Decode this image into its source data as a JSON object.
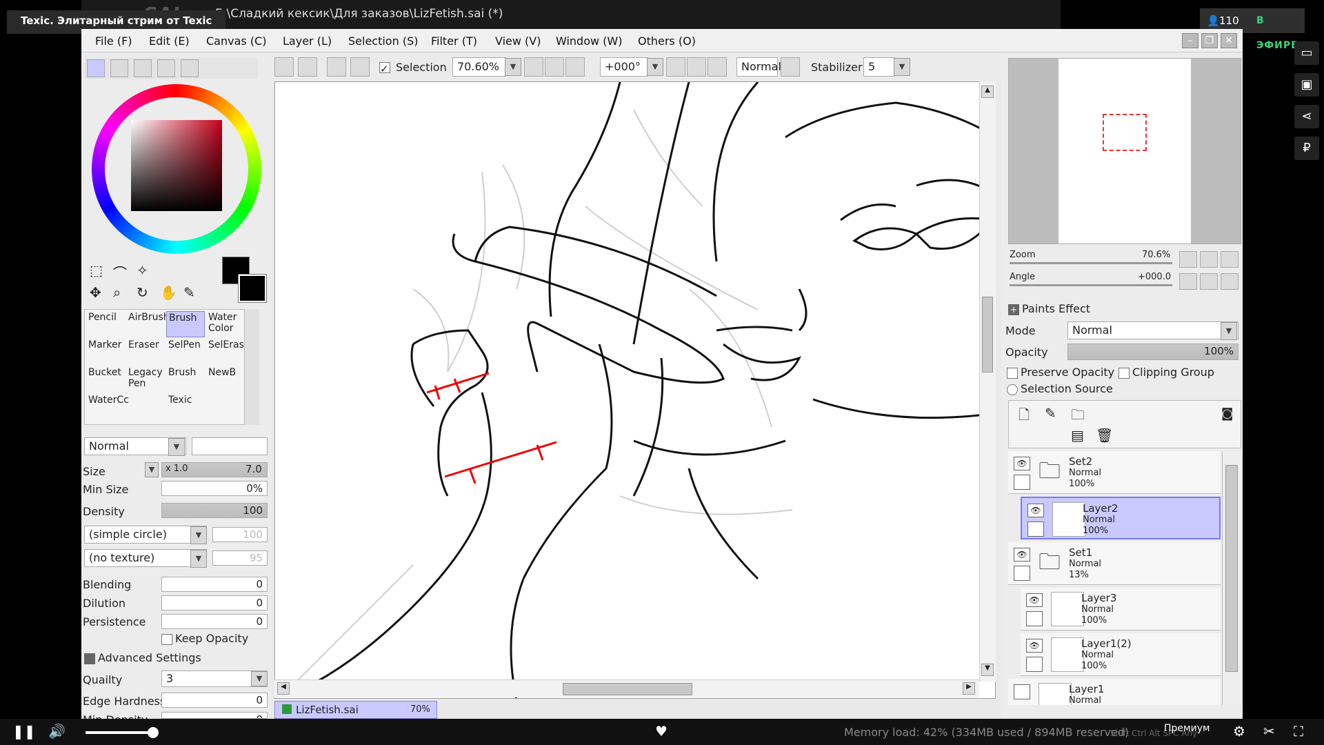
{
  "stream": {
    "title": "Texic. Элитарный стрим от Texic",
    "viewers": "110",
    "live": "В ЭФИРЕ",
    "premium": "Премиум"
  },
  "app": {
    "logo": "SAI",
    "path": "E:\\Сладкий кексик\\Для заказов\\LizFetish.sai (*)"
  },
  "menu": [
    "File (F)",
    "Edit (E)",
    "Canvas (C)",
    "Layer (L)",
    "Selection (S)",
    "Filter (T)",
    "View (V)",
    "Window (W)",
    "Others (O)"
  ],
  "toolbar": {
    "selection_label": "Selection",
    "zoom": "70.60%",
    "angle": "+000°",
    "blend": "Normal",
    "stabilizer_label": "Stabilizer",
    "stabilizer": "5"
  },
  "tools": [
    {
      "l1": "Pencil",
      "l2": ""
    },
    {
      "l1": "AirBrush",
      "l2": ""
    },
    {
      "l1": "Brush",
      "l2": ""
    },
    {
      "l1": "Water",
      "l2": "Color"
    },
    {
      "l1": "Marker",
      "l2": ""
    },
    {
      "l1": "Eraser",
      "l2": ""
    },
    {
      "l1": "SelPen",
      "l2": ""
    },
    {
      "l1": "SelEras",
      "l2": ""
    },
    {
      "l1": "Bucket",
      "l2": ""
    },
    {
      "l1": "Legacy",
      "l2": "Pen"
    },
    {
      "l1": "Brush",
      "l2": ""
    },
    {
      "l1": "NewB",
      "l2": ""
    },
    {
      "l1": "WaterCc",
      "l2": ""
    },
    {
      "l1": "",
      "l2": ""
    },
    {
      "l1": "Texic",
      "l2": ""
    },
    {
      "l1": "",
      "l2": ""
    }
  ],
  "brush": {
    "mode": "Normal",
    "size_label": "Size",
    "size_mult": "x 1.0",
    "size": "7.0",
    "minsize_label": "Min Size",
    "minsize": "0%",
    "density_label": "Density",
    "density": "100",
    "shape": "(simple circle)",
    "shape_val": "100",
    "texture": "(no texture)",
    "texture_val": "95",
    "blending_label": "Blending",
    "blending": "0",
    "dilution_label": "Dilution",
    "dilution": "0",
    "persistence_label": "Persistence",
    "persistence": "0",
    "keep_opacity": "Keep Opacity",
    "advanced": "Advanced Settings",
    "quality_label": "Quailty",
    "quality": "3",
    "edge_label": "Edge Hardness",
    "edge": "0",
    "mindensity_label": "Min Density",
    "mindensity": "0"
  },
  "navigator": {
    "zoom_label": "Zoom",
    "zoom": "70.6%",
    "angle_label": "Angle",
    "angle": "+000.0"
  },
  "layers_panel": {
    "paints_effect": "Paints Effect",
    "mode_label": "Mode",
    "mode": "Normal",
    "opacity_label": "Opacity",
    "opacity": "100%",
    "preserve": "Preserve Opacity",
    "clipping": "Clipping Group",
    "selection_source": "Selection Source"
  },
  "layers": [
    {
      "name": "Set2",
      "mode": "Normal",
      "opacity": "100%"
    },
    {
      "name": "Layer2",
      "mode": "Normal",
      "opacity": "100%"
    },
    {
      "name": "Set1",
      "mode": "Normal",
      "opacity": "13%"
    },
    {
      "name": "Layer3",
      "mode": "Normal",
      "opacity": "100%"
    },
    {
      "name": "Layer1(2)",
      "mode": "Normal",
      "opacity": "100%"
    },
    {
      "name": "Layer1",
      "mode": "Normal",
      "opacity": ""
    }
  ],
  "file_tab": {
    "name": "LizFetish.sai",
    "zoom": "70%"
  },
  "status": {
    "memory": "Memory load: 42% (334MB used / 894MB reserved)",
    "keys": "Shift Ctrl Alt SPC Any"
  },
  "colors": {
    "accent": "#c9c9ff",
    "live": "#3fd27a",
    "mark": "#e00000"
  }
}
